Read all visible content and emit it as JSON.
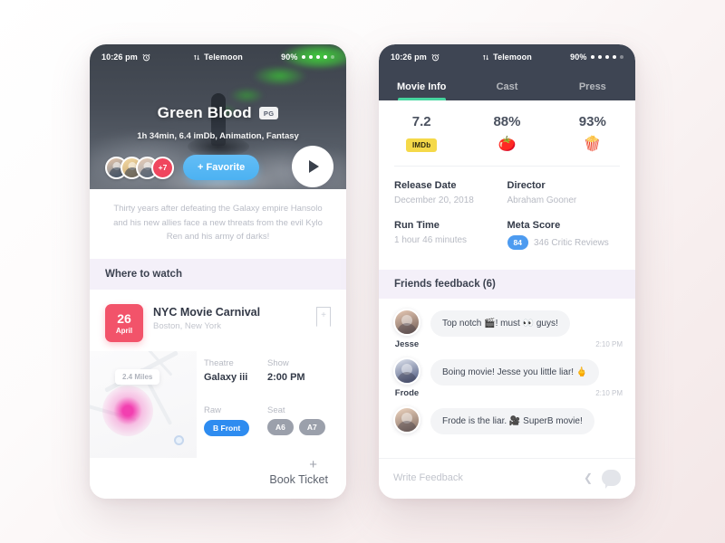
{
  "status_bar": {
    "time": "10:26 pm",
    "alarm_icon": "alarm-clock-icon",
    "transfer_icon": "data-transfer-icon",
    "carrier": "Telemoon",
    "battery": "90%",
    "signal_dots": 5,
    "signal_dots_filled": 4
  },
  "left_phone": {
    "hero": {
      "title": "Green Blood",
      "rating_badge": "PG",
      "subtitle": "1h 34min, 6.4 imDb, Animation, Fantasy",
      "avatar_overflow": "+7",
      "favorite_label": "+ Favorite",
      "play_icon": "play-icon"
    },
    "synopsis": "Thirty years after defeating the Galaxy empire Hansolo and his new allies face a new threats from the evil Kylo Ren and his army of darks!",
    "where_to_watch": {
      "section_title": "Where to watch",
      "date_day": "26",
      "date_month": "April",
      "venue_name": "NYC Movie Carnival",
      "venue_location": "Boston, New York",
      "bookmark_icon": "bookmark-add-icon",
      "map": {
        "distance_label": "2.4 Miles",
        "pin_icon": "location-pin-icon",
        "gps_icon": "gps-target-icon"
      },
      "details": [
        {
          "label": "Theatre",
          "value": "Galaxy iii"
        },
        {
          "label": "Show",
          "value": "2:00 PM"
        }
      ],
      "raw_label": "Raw",
      "raw_value": "B Front",
      "seat_label": "Seat",
      "seats": [
        "A6",
        "A7"
      ],
      "book_plus": "+",
      "book_label": "Book Ticket"
    }
  },
  "right_phone": {
    "tabs": [
      {
        "label": "Movie Info",
        "active": true
      },
      {
        "label": "Cast",
        "active": false
      },
      {
        "label": "Press",
        "active": false
      }
    ],
    "ratings": [
      {
        "value": "7.2",
        "icon": "imdb-badge-icon",
        "icon_label": "IMDb"
      },
      {
        "value": "88%",
        "icon": "rotten-tomato-icon",
        "icon_label": "🍅"
      },
      {
        "value": "93%",
        "icon": "popcorn-icon",
        "icon_label": "🍿"
      }
    ],
    "meta": [
      {
        "label": "Release Date",
        "value": "December 20, 2018"
      },
      {
        "label": "Director",
        "value": "Abraham Gooner"
      },
      {
        "label": "Run Time",
        "value": "1 hour 46 minutes"
      }
    ],
    "meta_score": {
      "label": "Meta Score",
      "score": "84",
      "reviews": "346 Critic Reviews"
    },
    "feedback": {
      "section_title": "Friends feedback (6)",
      "messages": [
        {
          "name": "Jesse",
          "text": "Top notch 🎬! must 👀 guys!",
          "time": "2:10 PM"
        },
        {
          "name": "Frode",
          "text": "Boing movie! Jesse you little liar! 🖕",
          "time": "2:10 PM"
        },
        {
          "name": "",
          "text": "Frode is the liar. 🎥 SuperB movie!",
          "time": ""
        }
      ],
      "input_placeholder": "Write Feedback",
      "prev_icon": "chevron-left-icon",
      "send_icon": "chat-bubble-icon"
    }
  },
  "colors": {
    "accent_blue": "#4cb2f2",
    "accent_green": "#47d6a0",
    "accent_red": "#f2536a",
    "imdb_yellow": "#f5d949",
    "meta_blue": "#4d9bf0",
    "band_lavender": "#f4f0f9",
    "dark_header": "#3e4553"
  }
}
